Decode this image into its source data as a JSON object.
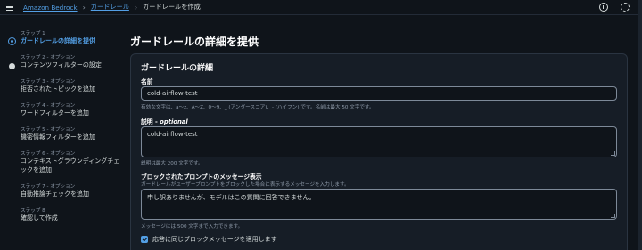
{
  "header": {
    "breadcrumbs": [
      "Amazon Bedrock",
      "ガードレール",
      "ガードレールを作成"
    ],
    "icons": [
      "menu-icon",
      "info-icon",
      "settings-icon"
    ]
  },
  "steps": [
    {
      "num": "ステップ 1",
      "label": "ガードレールの詳細を提供",
      "state": "active"
    },
    {
      "num": "ステップ 2 - オプション",
      "label": "コンテンツフィルターの設定",
      "state": "filled"
    },
    {
      "num": "ステップ 3 - オプション",
      "label": "拒否されたトピックを追加",
      "state": "empty"
    },
    {
      "num": "ステップ 4 - オプション",
      "label": "ワードフィルターを追加",
      "state": "empty"
    },
    {
      "num": "ステップ 5 - オプション",
      "label": "機密情報フィルターを追加",
      "state": "empty"
    },
    {
      "num": "ステップ 6 - オプション",
      "label": "コンテキストグラウンディングチェックを追加",
      "state": "empty"
    },
    {
      "num": "ステップ 7 - オプション",
      "label": "自動推論チェックを追加",
      "state": "empty"
    },
    {
      "num": "ステップ 8",
      "label": "確認して作成",
      "state": "empty"
    }
  ],
  "main": {
    "page_title": "ガードレールの詳細を提供",
    "panel_title": "ガードレールの詳細",
    "name": {
      "label": "名前",
      "value": "cold-airflow-test",
      "hint": "有効な文字は、a〜z、A〜Z、0〜9、_ (アンダースコア)、- (ハイフン) です。名前は最大 50 文字です。"
    },
    "description": {
      "label": "説明",
      "optional": "optional",
      "value": "cold-airflow-test",
      "hint": "説明は最大 200 文字です。"
    },
    "blocked_prompt": {
      "label": "ブロックされたプロンプトのメッセージ表示",
      "sublabel": "ガードレールがユーザープロンプトをブロックした場合に表示するメッセージを入力します。",
      "value": "申し訳ありませんが、モデルはこの質問に回答できません。",
      "hint": "メッセージには 500 文字まで入力できます。"
    },
    "apply_same_checkbox": {
      "label": "応答に同じブロックメッセージを適用します",
      "checked": true
    }
  }
}
